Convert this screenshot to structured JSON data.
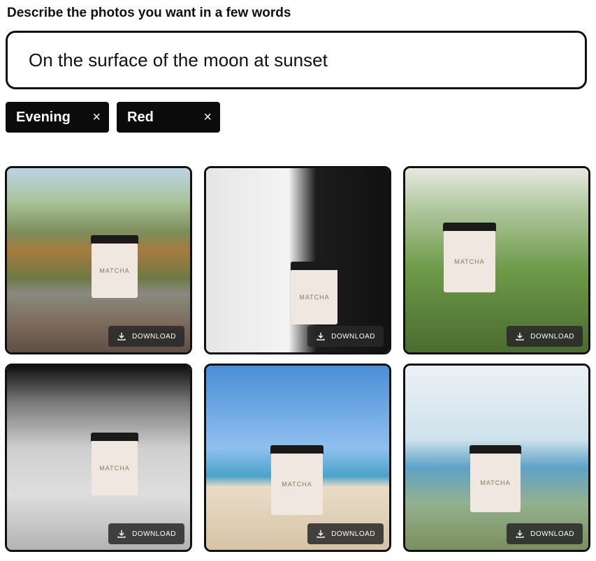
{
  "heading": "Describe the photos you want in a few words",
  "prompt": {
    "value": "On the surface of the moon at sunset"
  },
  "tags": [
    {
      "label": "Evening",
      "remove_icon": "×"
    },
    {
      "label": "Red",
      "remove_icon": "×"
    }
  ],
  "cards": [
    {
      "scene": "cliff",
      "download_label": "DOWNLOAD"
    },
    {
      "scene": "marble",
      "download_label": "DOWNLOAD"
    },
    {
      "scene": "garden",
      "download_label": "DOWNLOAD"
    },
    {
      "scene": "moon",
      "download_label": "DOWNLOAD"
    },
    {
      "scene": "beach",
      "download_label": "DOWNLOAD"
    },
    {
      "scene": "palm",
      "download_label": "DOWNLOAD"
    }
  ],
  "product": {
    "label": "MATCHA"
  },
  "icons": {
    "download": "download-icon"
  }
}
